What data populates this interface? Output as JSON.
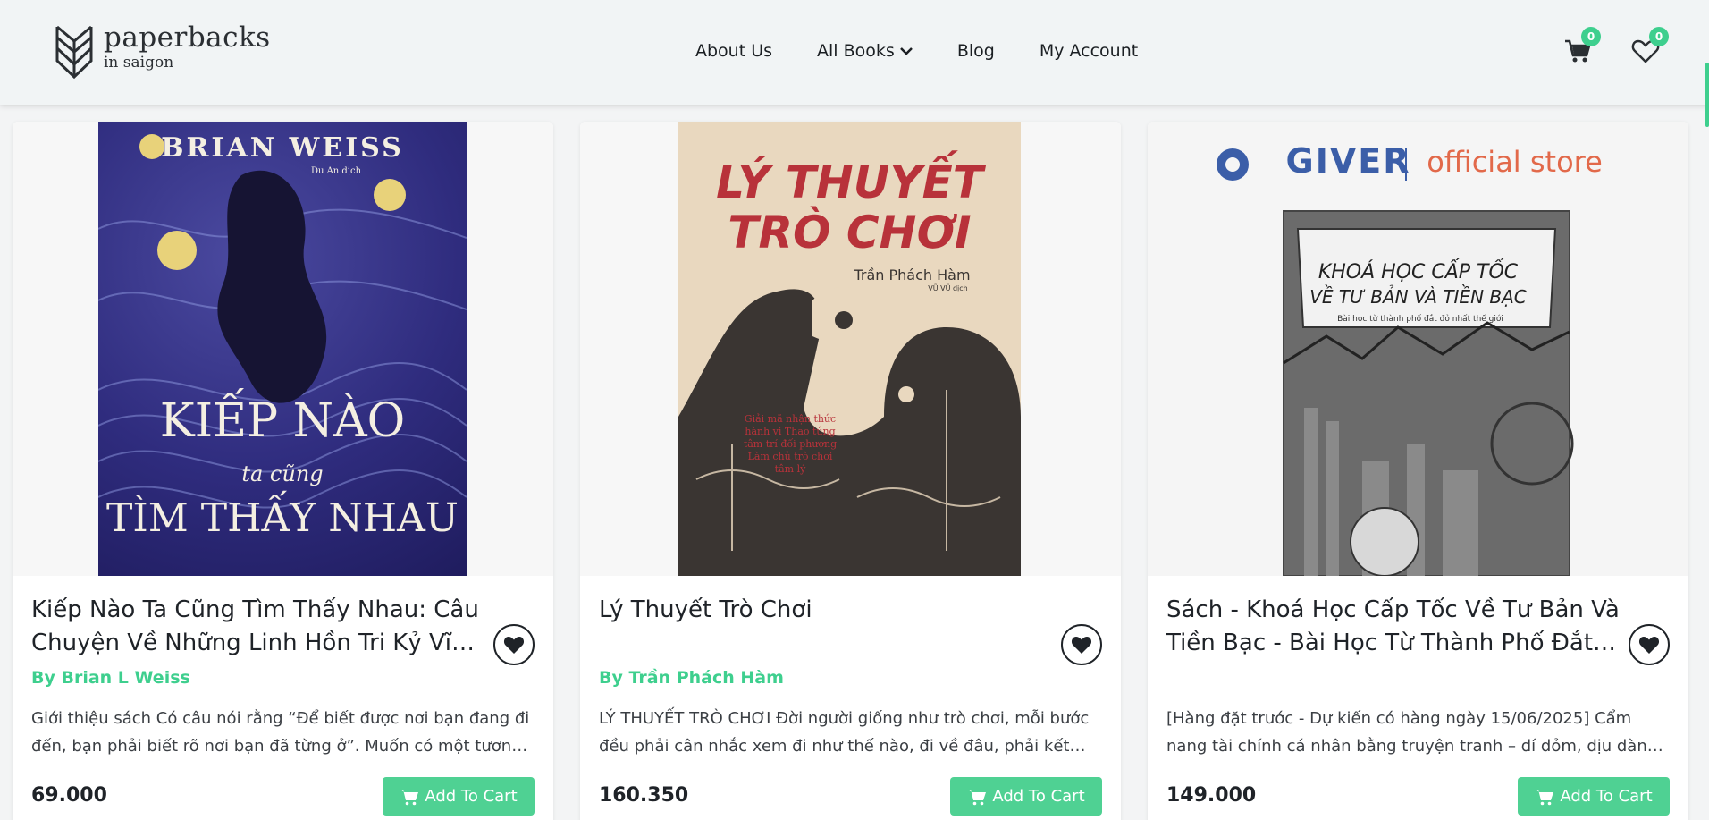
{
  "brand": {
    "name": "paperbacks",
    "tagline": "in saigon"
  },
  "nav": [
    {
      "label": "About Us"
    },
    {
      "label": "All Books"
    },
    {
      "label": "Blog"
    },
    {
      "label": "My Account"
    }
  ],
  "header_icons": {
    "cart_count": "0",
    "wishlist_count": "0"
  },
  "colors": {
    "accent": "#3ecf8e",
    "button": "#4fd193"
  },
  "products": [
    {
      "title": "Kiếp Nào Ta Cũng Tìm Thấy Nhau: Câu Chuyện Về Những Linh Hồn Tri Kỷ Vĩnh Hằng",
      "author": "By Brian L Weiss",
      "description": "Giới thiệu sách Có câu nói rằng “Để biết được nơi bạn đang đi đến, bạn phải biết rõ nơi bạn đã từng ở”. Muốn có một tương lai",
      "price": "69.000",
      "add_label": "Add To Cart",
      "cover": {
        "author": "BRIAN WEISS",
        "translator": "Du An dịch",
        "line1": "KIẾP NÀO",
        "line2": "ta cũng",
        "line3": "TÌM THẤY NHAU"
      }
    },
    {
      "title": "Lý Thuyết Trò Chơi",
      "author": "By Trần Phách Hàm",
      "description": "LÝ THUYẾT TRÒ CHƠI Đời người giống như trò chơi, mỗi bước đều phải cân nhắc xem đi như thế nào, đi về đâu, phải kết hợp",
      "price": "160.350",
      "add_label": "Add To Cart",
      "cover": {
        "line1": "LÝ THUYẾT",
        "line2": "TRÒ CHƠI",
        "author": "Trần Phách Hàm",
        "translator": "VŨ VŨ dịch",
        "blurb": "Giải mã nhận thức hành vi Thao túng tâm trí đối phương Làm chủ trò chơi tâm lý"
      }
    },
    {
      "title": "Sách - Khoá Học Cấp Tốc Về Tư Bản Và Tiền Bạc - Bài Học Từ Thành Phố Đắt Đỏ Nhất Thế Giới",
      "author": "",
      "description": "[Hàng đặt trước - Dự kiến có hàng ngày 15/06/2025] Cẩm nang tài chính cá nhân bằng truyện tranh – dí dỏm, dịu dàng, nhưng",
      "price": "149.000",
      "add_label": "Add To Cart",
      "cover": {
        "brand": "GIVER",
        "store": "official store",
        "line1": "KHOÁ HỌC CẤP TỐC",
        "line2": "VỀ TƯ BẢN VÀ TIỀN BẠC",
        "line3": "Bài học từ thành phố đắt đỏ nhất thế giới"
      }
    }
  ]
}
